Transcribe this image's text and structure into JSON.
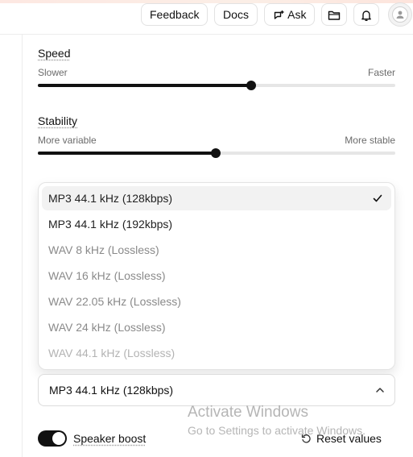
{
  "header": {
    "feedback_label": "Feedback",
    "docs_label": "Docs",
    "ask_label": "Ask",
    "icons": [
      "ask-icon",
      "folder-icon",
      "bell-icon",
      "avatar"
    ]
  },
  "speed": {
    "label": "Speed",
    "min_label": "Slower",
    "max_label": "Faster",
    "value_fraction": 0.597
  },
  "stability": {
    "label": "Stability",
    "min_label": "More variable",
    "max_label": "More stable",
    "value_fraction": 0.498
  },
  "format_dropdown": {
    "options": [
      {
        "label": "MP3 44.1 kHz (128kbps)",
        "selected": true
      },
      {
        "label": "MP3 44.1 kHz (192kbps)"
      },
      {
        "label": "WAV 8 kHz (Lossless)"
      },
      {
        "label": "WAV 16 kHz (Lossless)"
      },
      {
        "label": "WAV 22.05 kHz (Lossless)"
      },
      {
        "label": "WAV 24 kHz (Lossless)"
      },
      {
        "label": "WAV 44.1 kHz (Lossless)"
      }
    ]
  },
  "format_select": {
    "value": "MP3 44.1 kHz (128kbps)"
  },
  "speaker_boost": {
    "label": "Speaker boost",
    "enabled": true
  },
  "reset": {
    "label": "Reset values"
  },
  "watermark": {
    "line1": "Activate Windows",
    "line2": "Go to Settings to activate Windows."
  },
  "colors": {
    "accent": "#111111",
    "track": "#e6e6e6",
    "selected_bg": "#f2f2f2"
  }
}
